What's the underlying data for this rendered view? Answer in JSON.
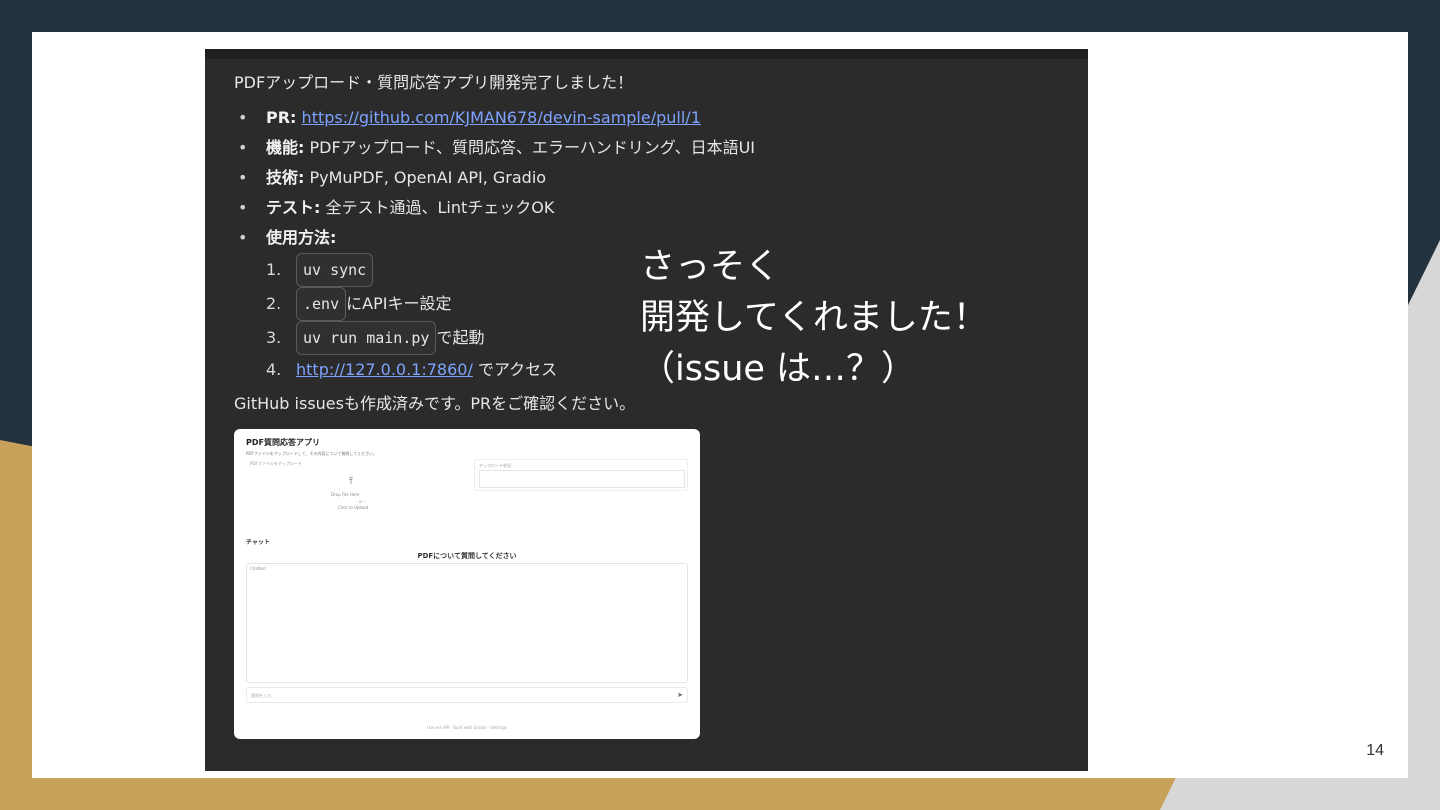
{
  "slide": {
    "page_number": "14"
  },
  "message": {
    "title": "PDFアップロード・質問応答アプリ開発完了しました！",
    "bullets": [
      {
        "key": "PR:",
        "value": "https://github.com/KJMAN678/devin-sample/pull/1"
      },
      {
        "key": "機能:",
        "value": "PDFアップロード、質問応答、エラーハンドリング、日本語UI"
      },
      {
        "key": "技術:",
        "value": "PyMuPDF, OpenAI API, Gradio"
      },
      {
        "key": "テスト:",
        "value": "全テスト通過、LintチェックOK"
      },
      {
        "key": "使用方法:",
        "value": ""
      }
    ],
    "steps": [
      {
        "num": "1.",
        "code": "uv sync",
        "text": ""
      },
      {
        "num": "2.",
        "code": ".env",
        "text": "にAPIキー設定"
      },
      {
        "num": "3.",
        "code": "uv run main.py",
        "text": "で起動"
      },
      {
        "num": "4.",
        "link": "http://127.0.0.1:7860/",
        "text": "でアクセス"
      }
    ],
    "footer": "GitHub issuesも作成済みです。PRをご確認ください。"
  },
  "app_preview": {
    "title": "PDF質問応答アプリ",
    "description": "PDFファイルをアップロードして、その内容について質問してください。",
    "upload_label": "PDFファイルをアップロード",
    "upload_drop": "Drop File Here",
    "upload_or": "- or -",
    "upload_click": "Click to Upload",
    "status_label": "アップロード状況",
    "chat_heading": "チャット",
    "chat_center": "PDFについて質問してください",
    "chatbot_label": "Chatbot",
    "input_placeholder": "質問を入力",
    "footer": "Use via API · Built with Gradio · Settings"
  },
  "annotation": {
    "lines": [
      "さっそく",
      "開発してくれました！",
      "（issue は…？）"
    ]
  }
}
